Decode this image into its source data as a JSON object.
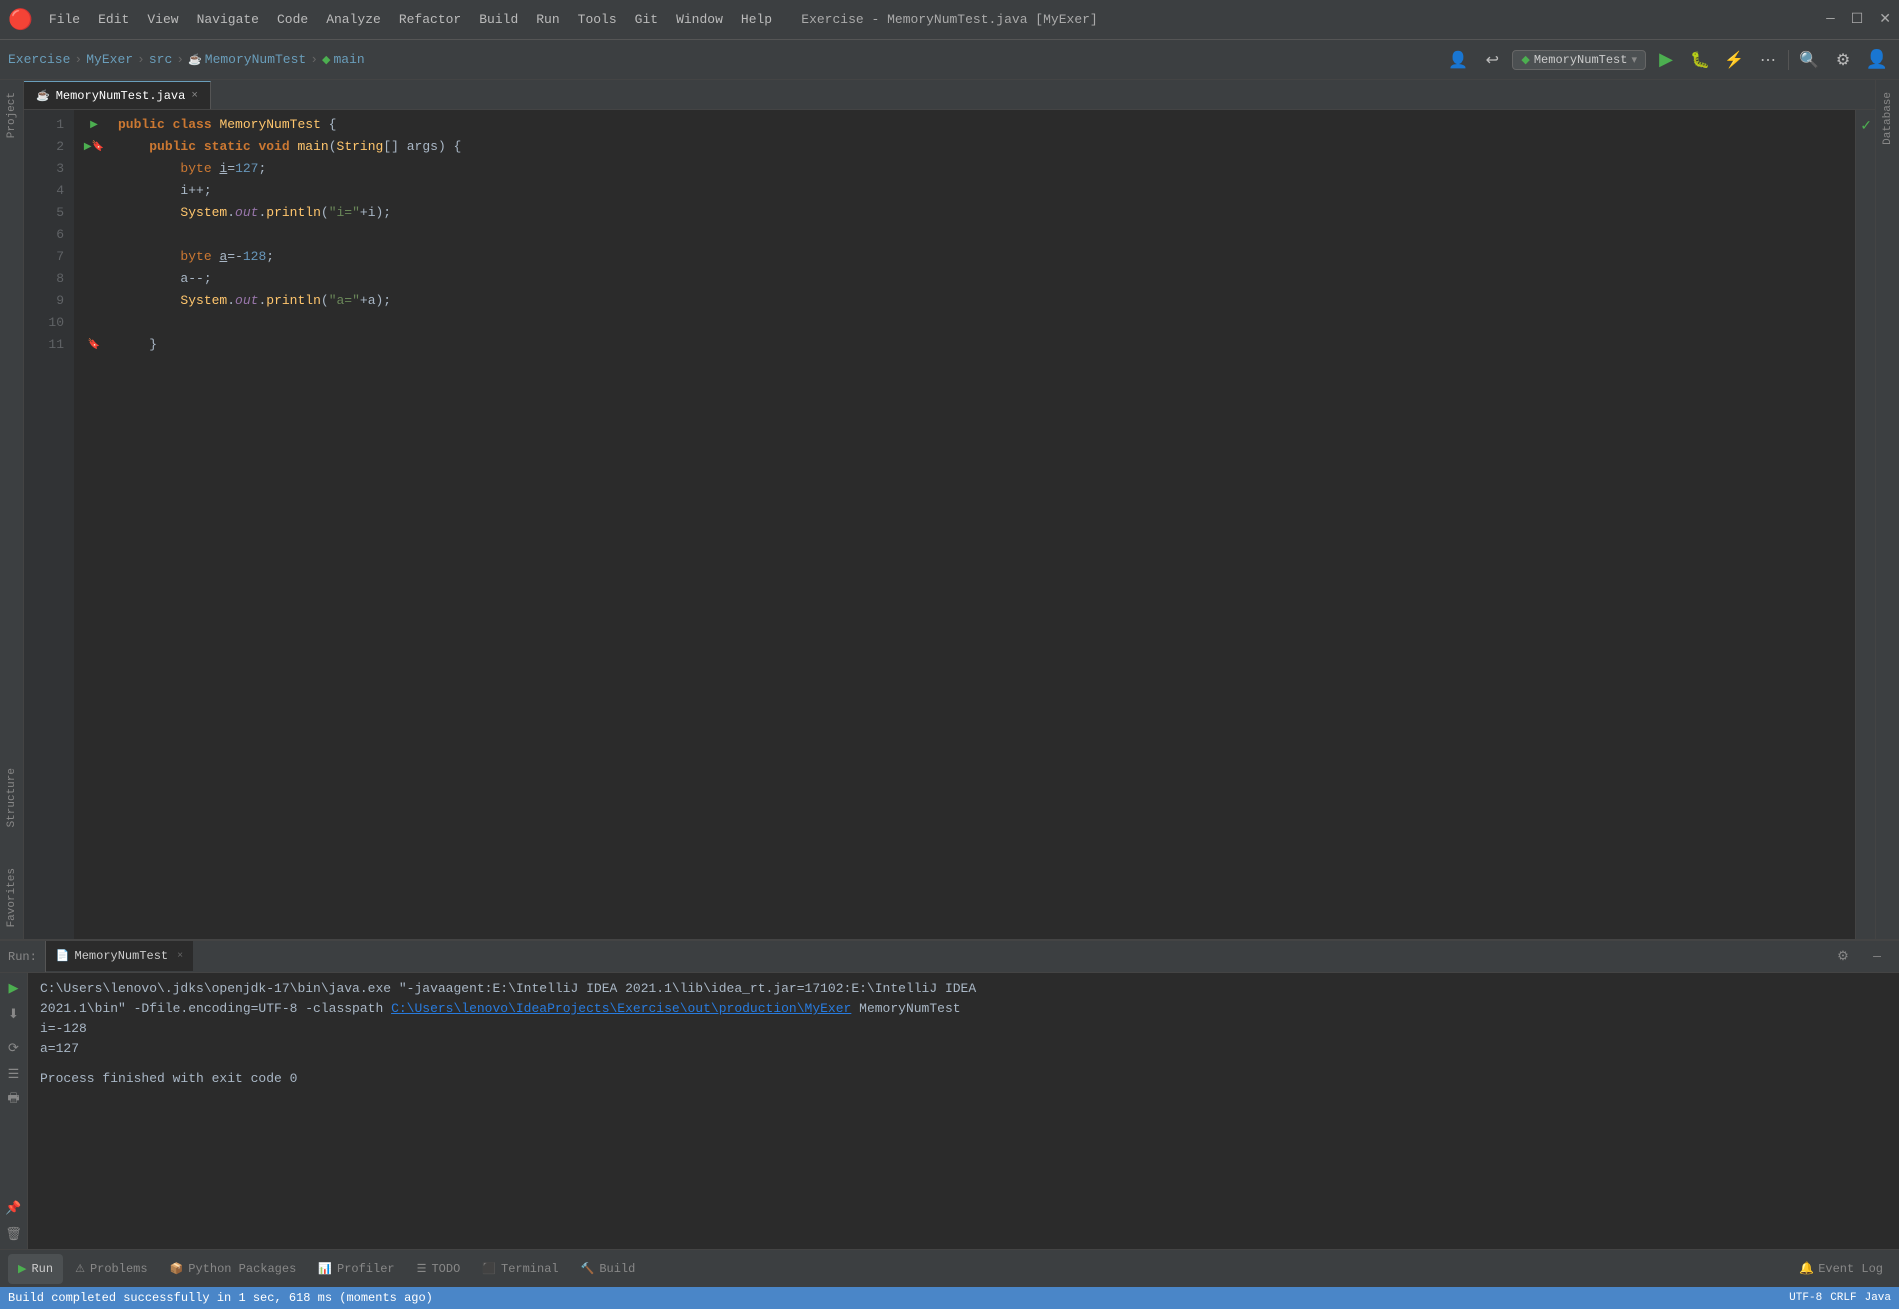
{
  "window": {
    "title": "Exercise - MemoryNumTest.java [MyExer]",
    "minimize": "—",
    "maximize": "☐",
    "close": "✕"
  },
  "menu": {
    "items": [
      "File",
      "Edit",
      "View",
      "Navigate",
      "Code",
      "Analyze",
      "Refactor",
      "Build",
      "Run",
      "Tools",
      "Git",
      "Window",
      "Help"
    ]
  },
  "breadcrumb": {
    "items": [
      "Exercise",
      "MyExer",
      "src",
      "MemoryNumTest",
      "main"
    ]
  },
  "run_config": {
    "name": "MemoryNumTest",
    "chevron": "▾"
  },
  "editor": {
    "tab": {
      "label": "MemoryNumTest.java",
      "icon": "☕",
      "close": "×"
    },
    "lines": [
      {
        "num": "1",
        "indent": "",
        "content": "public class MemoryNumTest {"
      },
      {
        "num": "2",
        "indent": "    ",
        "content": "public static void main(String[] args) {"
      },
      {
        "num": "3",
        "indent": "        ",
        "content": "byte i=127;"
      },
      {
        "num": "4",
        "indent": "        ",
        "content": "i++;"
      },
      {
        "num": "5",
        "indent": "        ",
        "content": "System.out.println(\"i=\"+i);"
      },
      {
        "num": "6",
        "indent": "",
        "content": ""
      },
      {
        "num": "7",
        "indent": "        ",
        "content": "byte a=-128;"
      },
      {
        "num": "8",
        "indent": "        ",
        "content": "a--;"
      },
      {
        "num": "9",
        "indent": "        ",
        "content": "System.out.println(\"a=\"+a);"
      },
      {
        "num": "10",
        "indent": "",
        "content": ""
      },
      {
        "num": "11",
        "indent": "    ",
        "content": "}"
      }
    ]
  },
  "bottom_panel": {
    "run_label": "Run:",
    "active_tab": "MemoryNumTest",
    "tab_close": "×",
    "output": {
      "cmd_line1": "C:\\Users\\lenovo\\.jdks\\openjdk-17\\bin\\java.exe \"-javaagent:E:\\IntelliJ IDEA 2021.1\\lib\\idea_rt.jar=17102:E:\\IntelliJ IDEA",
      "cmd_line2": "    2021.1\\bin\" -Dfile.encoding=UTF-8 -classpath ",
      "link_text": "C:\\Users\\lenovo\\IdeaProjects\\Exercise\\out\\production\\MyExer",
      "cmd_line3": " MemoryNumTest",
      "output1": "i=-128",
      "output2": "a=127",
      "exit_msg": "Process finished with exit code 0"
    }
  },
  "bottom_tabs": [
    {
      "label": "Run",
      "icon": "▶",
      "active": true
    },
    {
      "label": "Problems",
      "icon": "⚠",
      "active": false
    },
    {
      "label": "Python Packages",
      "icon": "📦",
      "active": false
    },
    {
      "label": "Profiler",
      "icon": "📊",
      "active": false
    },
    {
      "label": "TODO",
      "icon": "☰",
      "active": false
    },
    {
      "label": "Terminal",
      "icon": "⬛",
      "active": false
    },
    {
      "label": "Build",
      "icon": "🔨",
      "active": false
    }
  ],
  "status_bar": {
    "message": "Build completed successfully in 1 sec, 618 ms (moments ago)"
  },
  "event_log": "Event Log",
  "right_panel_tabs": [
    "Database"
  ],
  "left_panel_tabs": [
    "Project",
    "Structure",
    "Favorites"
  ],
  "sidebar_icons": [
    "project",
    "structure",
    "favorites"
  ]
}
